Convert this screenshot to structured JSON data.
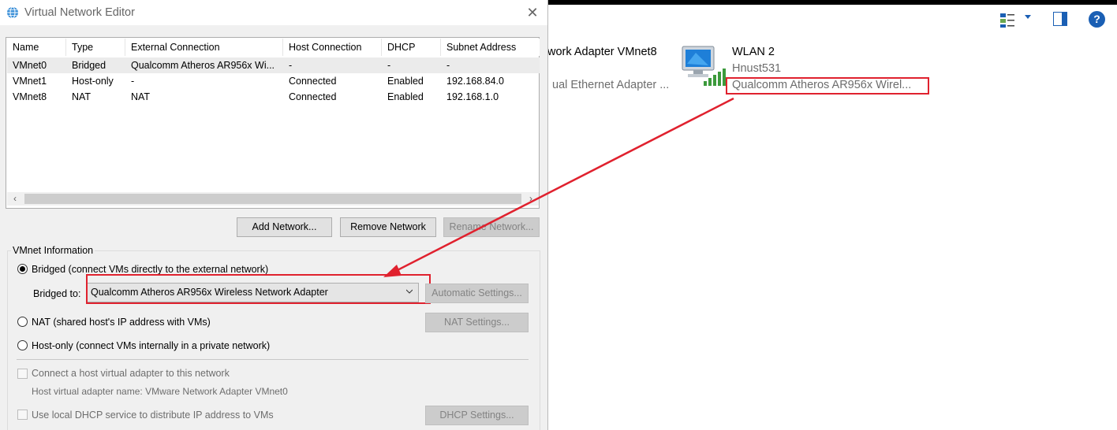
{
  "background": {
    "partial_title": "work Adapter VMnet8",
    "partial_desc": "ual Ethernet Adapter ...",
    "wlan_name": "WLAN 2",
    "wlan_ssid": "Hnust531",
    "wlan_adapter": "Qualcomm Atheros AR956x Wirel...",
    "toolbar_icons": [
      "view-options-icon",
      "preview-pane-icon",
      "help-icon"
    ],
    "help_glyph": "?"
  },
  "dialog": {
    "title": "Virtual Network Editor",
    "close_glyph": "✕",
    "table": {
      "headers": [
        "Name",
        "Type",
        "External Connection",
        "Host Connection",
        "DHCP",
        "Subnet Address"
      ],
      "rows": [
        [
          "VMnet0",
          "Bridged",
          "Qualcomm Atheros AR956x Wi...",
          "-",
          "-",
          "-"
        ],
        [
          "VMnet1",
          "Host-only",
          "-",
          "Connected",
          "Enabled",
          "192.168.84.0"
        ],
        [
          "VMnet8",
          "NAT",
          "NAT",
          "Connected",
          "Enabled",
          "192.168.1.0"
        ]
      ],
      "selected_row": 0
    },
    "buttons": {
      "add": "Add Network...",
      "remove": "Remove Network",
      "rename": "Rename Network..."
    },
    "vmnet_info": {
      "group_title": "VMnet Information",
      "bridged_label": "Bridged (connect VMs directly to the external network)",
      "bridged_to_label": "Bridged to:",
      "bridged_to_value": "Qualcomm Atheros AR956x Wireless Network Adapter",
      "automatic_settings": "Automatic Settings...",
      "nat_label": "NAT (shared host's IP address with VMs)",
      "nat_settings": "NAT Settings...",
      "hostonly_label": "Host-only (connect VMs internally in a private network)",
      "connect_adapter_label": "Connect a host virtual adapter to this network",
      "adapter_name_label": "Host virtual adapter name: VMware Network Adapter VMnet0",
      "dhcp_label": "Use local DHCP service to distribute IP address to VMs",
      "dhcp_settings": "DHCP Settings...",
      "selected_mode": "Bridged"
    }
  },
  "annotation_color": "#e0212e"
}
